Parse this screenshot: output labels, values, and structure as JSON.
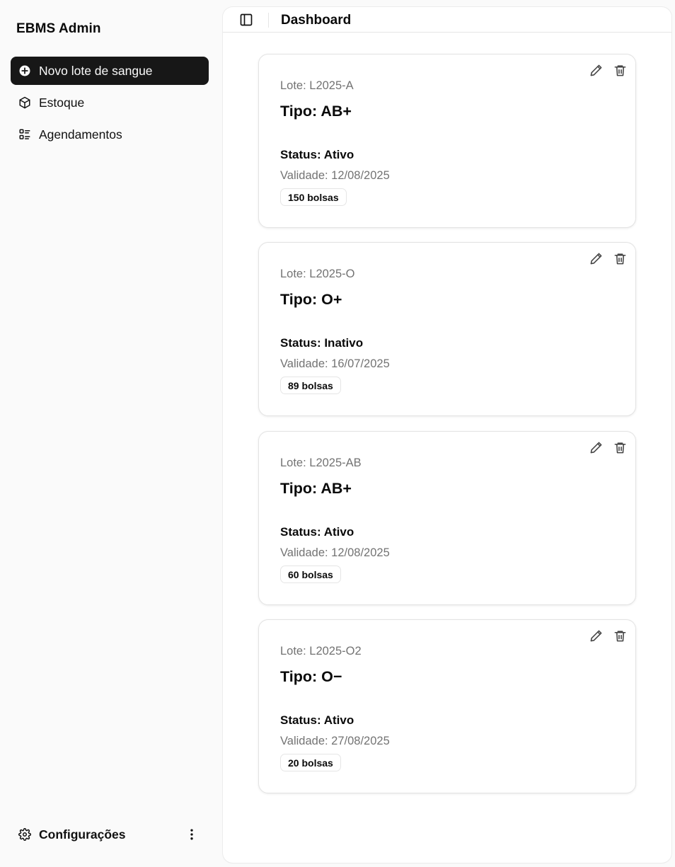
{
  "sidebar": {
    "app_title": "EBMS Admin",
    "items": [
      {
        "label": "Novo lote de sangue",
        "icon": "plus-circle-icon",
        "active": true
      },
      {
        "label": "Estoque",
        "icon": "package-icon",
        "active": false
      },
      {
        "label": "Agendamentos",
        "icon": "list-icon",
        "active": false
      }
    ],
    "footer": {
      "label": "Configurações",
      "icon": "gear-icon",
      "more_icon": "more-vertical-icon"
    }
  },
  "header": {
    "toggle_icon": "panel-left-icon",
    "title": "Dashboard"
  },
  "cards": [
    {
      "lote": "Lote: L2025-A",
      "tipo": "Tipo: AB+",
      "status": "Status: Ativo",
      "validade": "Validade: 12/08/2025",
      "bolsas": "150 bolsas"
    },
    {
      "lote": "Lote: L2025-O",
      "tipo": "Tipo: O+",
      "status": "Status: Inativo",
      "validade": "Validade: 16/07/2025",
      "bolsas": "89 bolsas"
    },
    {
      "lote": "Lote: L2025-AB",
      "tipo": "Tipo: AB+",
      "status": "Status: Ativo",
      "validade": "Validade: 12/08/2025",
      "bolsas": "60 bolsas"
    },
    {
      "lote": "Lote: L2025-O2",
      "tipo": "Tipo: O−",
      "status": "Status: Ativo",
      "validade": "Validade: 27/08/2025",
      "bolsas": "20 bolsas"
    }
  ],
  "card_actions": {
    "edit_icon": "pencil-icon",
    "delete_icon": "trash-icon"
  },
  "colors": {
    "active_bg": "#171717",
    "muted_text": "#737373",
    "border": "#e5e5e5"
  }
}
